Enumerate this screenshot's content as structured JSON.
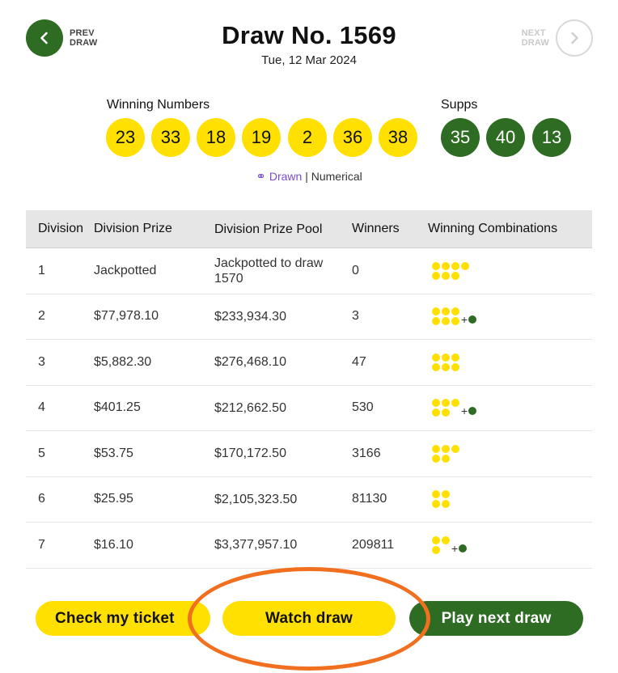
{
  "nav": {
    "prev_line1": "PREV",
    "prev_line2": "DRAW",
    "next_line1": "NEXT",
    "next_line2": "DRAW"
  },
  "header": {
    "title": "Draw No. 1569",
    "date": "Tue, 12 Mar 2024"
  },
  "numbers": {
    "winning_label": "Winning Numbers",
    "winning": [
      "23",
      "33",
      "18",
      "19",
      "2",
      "36",
      "38"
    ],
    "supps_label": "Supps",
    "supps": [
      "35",
      "40",
      "13"
    ]
  },
  "order_toggle": {
    "drawn": "Drawn",
    "separator": "|",
    "numerical": "Numerical"
  },
  "table": {
    "headers": [
      "Division",
      "Division Prize",
      "Division Prize Pool",
      "Winners",
      "Winning Combinations"
    ],
    "rows": [
      {
        "division": "1",
        "prize": "Jackpotted",
        "pool": "Jackpotted to draw 1570",
        "winners": "0"
      },
      {
        "division": "2",
        "prize": "$77,978.10",
        "pool": "$233,934.30",
        "winners": "3"
      },
      {
        "division": "3",
        "prize": "$5,882.30",
        "pool": "$276,468.10",
        "winners": "47"
      },
      {
        "division": "4",
        "prize": "$401.25",
        "pool": "$212,662.50",
        "winners": "530"
      },
      {
        "division": "5",
        "prize": "$53.75",
        "pool": "$170,172.50",
        "winners": "3166"
      },
      {
        "division": "6",
        "prize": "$25.95",
        "pool": "$2,105,323.50",
        "winners": "81130"
      },
      {
        "division": "7",
        "prize": "$16.10",
        "pool": "$3,377,957.10",
        "winners": "209811"
      }
    ]
  },
  "buttons": {
    "check": "Check my ticket",
    "watch": "Watch draw",
    "play": "Play next draw"
  },
  "colors": {
    "yellow": "#ffe000",
    "green": "#2e6b23",
    "highlight": "#f07020",
    "drawn_purple": "#7b4bd1"
  }
}
